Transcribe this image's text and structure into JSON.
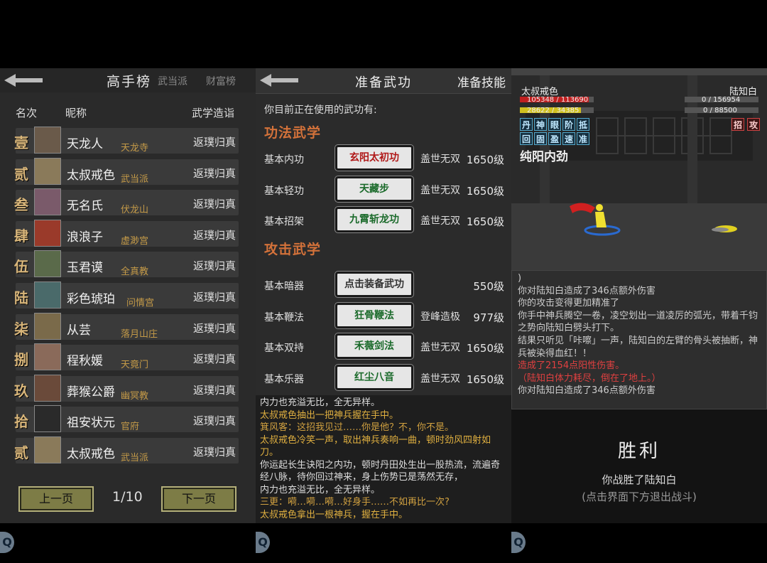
{
  "leaderboard": {
    "title": "高手榜",
    "tabs": [
      "武当派",
      "财富榜"
    ],
    "columns": {
      "rank": "名次",
      "name": "昵称",
      "level": "武学造诣"
    },
    "rows": [
      {
        "rank": "壹",
        "name": "天龙人",
        "sect": "天龙寺",
        "level": "返璞归真"
      },
      {
        "rank": "贰",
        "name": "太叔戒色",
        "sect": "武当派",
        "level": "返璞归真"
      },
      {
        "rank": "叁",
        "name": "无名氏",
        "sect": "伏龙山",
        "level": "返璞归真"
      },
      {
        "rank": "肆",
        "name": "浪浪子",
        "sect": "虚渺宫",
        "level": "返璞归真"
      },
      {
        "rank": "伍",
        "name": "玉君谟",
        "sect": "全真教",
        "level": "返璞归真"
      },
      {
        "rank": "陆",
        "name": "彩色琥珀",
        "sect": "问情宫",
        "level": "返璞归真"
      },
      {
        "rank": "柒",
        "name": "从芸",
        "sect": "落月山庄",
        "level": "返璞归真"
      },
      {
        "rank": "捌",
        "name": "程秋媛",
        "sect": "天竟门",
        "level": "返璞归真"
      },
      {
        "rank": "玖",
        "name": "葬猴公爵",
        "sect": "幽冥教",
        "level": "返璞归真"
      },
      {
        "rank": "拾",
        "name": "祖安状元",
        "sect": "官府",
        "level": "返璞归真"
      },
      {
        "rank": "贰",
        "name": "太叔戒色",
        "sect": "武当派",
        "level": "返璞归真"
      }
    ],
    "prev_label": "上一页",
    "next_label": "下一页",
    "page": "1/10"
  },
  "equip": {
    "title": "准备武功",
    "tab": "准备技能",
    "intro": "你目前正在使用的武功有:",
    "section_internal": "功法武学",
    "section_attack": "攻击武学",
    "internal": [
      {
        "label": "基本内功",
        "skill": "玄阳太初功",
        "color": "#b01818",
        "grade": "盖世无双",
        "level": "1650级"
      },
      {
        "label": "基本轻功",
        "skill": "天藏步",
        "color": "#1a6a2a",
        "grade": "盖世无双",
        "level": "1650级"
      },
      {
        "label": "基本招架",
        "skill": "九霄斩龙功",
        "color": "#1a6a2a",
        "grade": "盖世无双",
        "level": "1650级"
      }
    ],
    "attack": [
      {
        "label": "基本暗器",
        "skill": "点击装备武功",
        "color": "#333333",
        "grade": "",
        "level": "550级"
      },
      {
        "label": "基本鞭法",
        "skill": "狂骨鞭法",
        "color": "#1a6a2a",
        "grade": "登峰造极",
        "level": "977级"
      },
      {
        "label": "基本双持",
        "skill": "禾薇剑法",
        "color": "#1a6a2a",
        "grade": "盖世无双",
        "level": "1650级"
      },
      {
        "label": "基本乐器",
        "skill": "红尘八音",
        "color": "#1a6a2a",
        "grade": "盖世无双",
        "level": "1650级"
      }
    ],
    "log": [
      "内力也充溢无比，全无异样。",
      "太叔戒色抽出一把神兵握在手中。",
      "箕风客：这招我见过……你是他？不，你不是。",
      "太叔戒色冷笑一声，取出神兵奏响一曲，顿时劲风四射如刀。",
      "你运起长生诀阳之内功，顿时丹田处生出一股热流，流遍奇经八脉，待你回过神来，身上伤势已是荡然无存，",
      "内力也充溢无比，全无异样。",
      "三更：嗬…嗬…嗬…好身手……不如再比一次?",
      "太叔戒色拿出一根神兵，握在手中。"
    ]
  },
  "battle": {
    "player_name": "太叔戒色",
    "player_hp": "105348 / 113690",
    "player_mp": "28622 / 34385",
    "enemy_name": "陆知白",
    "enemy_hp": "0 / 156954",
    "enemy_mp": "0 / 88500",
    "player_buffs": [
      "丹",
      "神",
      "眼",
      "阶",
      "抵",
      "回",
      "固",
      "盈",
      "速",
      "准"
    ],
    "enemy_buffs": [
      "招",
      "攻"
    ],
    "skill_name": "纯阳内劲",
    "log": [
      ")",
      "你对陆知白造成了346点额外伤害",
      "你的攻击变得更加精准了",
      "你手中神兵腾空一卷，凌空划出一道凌厉的弧光，带着千钧之势向陆知白劈头打下。",
      "结果只听见「咔嚓」一声，陆知白的左臂的骨头被抽断，神兵被染得血红！！",
      "造成了2154点阳性伤害。",
      "（陆知白体力耗尽，倒在了地上。）",
      "你对陆知白造成了346点额外伤害"
    ],
    "victory_title": "胜利",
    "victory_text": "你战胜了陆知白",
    "victory_hint": "(点击界面下方退出战斗)"
  },
  "colors": {
    "gold": "#c49a48",
    "section": "#d4723a",
    "button": "#7d7c46"
  }
}
